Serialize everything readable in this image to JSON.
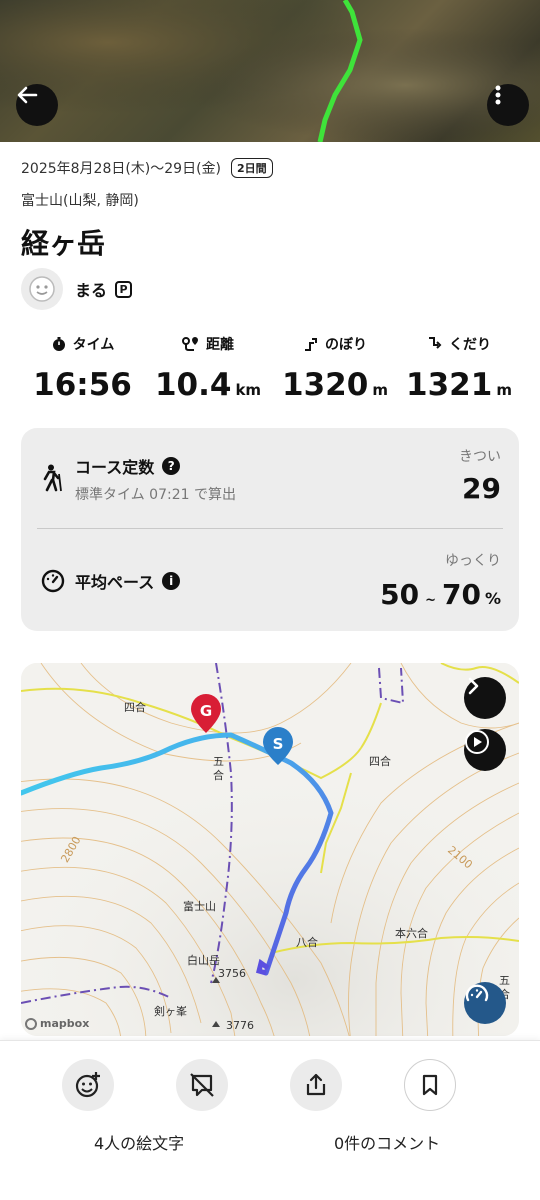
{
  "header": {
    "back_icon": "arrow-left-icon",
    "more_icon": "more-vertical-icon"
  },
  "info": {
    "date": "2025年8月28日(木)〜29日(金)",
    "days_badge": "2日間",
    "place": "富士山(山梨, 静岡)",
    "title": "経ヶ岳",
    "user_name": "まる",
    "user_badge": "P"
  },
  "stats": {
    "time": {
      "label": "タイム",
      "value": "16:56",
      "unit": ""
    },
    "distance": {
      "label": "距離",
      "value": "10.4",
      "unit": "km"
    },
    "ascent": {
      "label": "のぼり",
      "value": "1320",
      "unit": "m"
    },
    "descent": {
      "label": "くだり",
      "value": "1321",
      "unit": "m"
    }
  },
  "course": {
    "title": "コース定数",
    "help_icon": "question-circle-icon",
    "subtitle": "標準タイム 07:21 で算出",
    "difficulty_label": "きつい",
    "value": "29"
  },
  "pace": {
    "title": "平均ペース",
    "info_icon": "info-circle-icon",
    "speed_label": "ゆっくり",
    "min": "50",
    "separator": "~",
    "max": "70",
    "unit": "%"
  },
  "map": {
    "labels": {
      "yongo_1": "四合",
      "yongo_2": "四合",
      "gogo": "五合",
      "fujisan": "富士山",
      "hakusandake": "白山岳",
      "elev_1": "3756",
      "elev_2": "3776",
      "kengamine": "剣ヶ峯",
      "hachigo": "八合",
      "honhachigo": "本六合",
      "gogo_right": "五合",
      "contour_2800": "2800",
      "contour_2100": "2100"
    },
    "start_marker": "S",
    "goal_marker": "G",
    "attribution": "mapbox",
    "colors": {
      "route_start": "#3fd3ee",
      "route_end": "#5b4fe0",
      "start_marker": "#2b7fc9",
      "goal_marker": "#d81e35"
    }
  },
  "actions": {
    "emoji_count": "4人の絵文字",
    "comment_count": "0件のコメント"
  }
}
